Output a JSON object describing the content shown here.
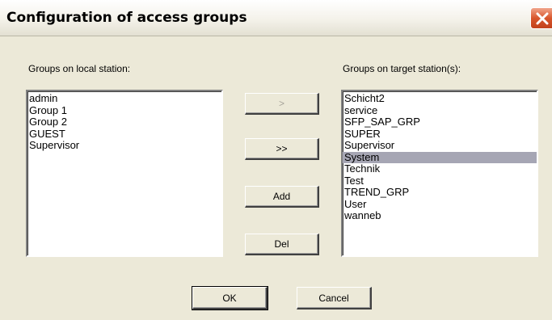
{
  "window": {
    "title": "Configuration of access groups"
  },
  "local": {
    "label": "Groups on local station:",
    "items": [
      "admin",
      "Group 1",
      "Group 2",
      "GUEST",
      "Supervisor"
    ]
  },
  "target": {
    "label": "Groups on target station(s):",
    "items": [
      "Schicht2",
      "service",
      "SFP_SAP_GRP",
      "SUPER",
      "Supervisor",
      "System",
      "Technik",
      "Test",
      "TREND_GRP",
      "User",
      "wanneb"
    ],
    "selected_index": 5
  },
  "buttons": {
    "move_one": ">",
    "move_all": ">>",
    "add": "Add",
    "del": "Del",
    "ok": "OK",
    "cancel": "Cancel"
  },
  "icons": {
    "close": "close-icon"
  },
  "colors": {
    "dialog_bg": "#ece9d8",
    "selection": "#a6a6b4",
    "close_button": "#d8562c"
  }
}
